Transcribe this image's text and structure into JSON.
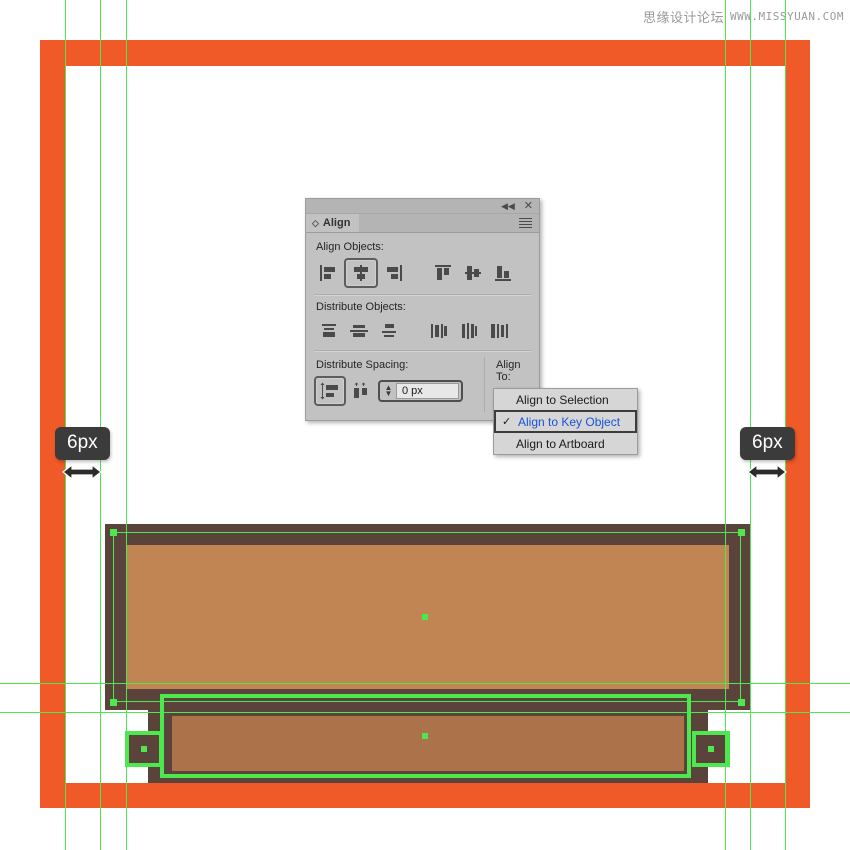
{
  "watermark": {
    "chinese": "思缘设计论坛",
    "url": "WWW.MISSYUAN.COM"
  },
  "panel": {
    "tab_label": "Align",
    "collapse_icon": "double-chevron-left-icon",
    "close_icon": "close-icon",
    "menu_icon": "hamburger-menu-icon",
    "sections": {
      "align_objects_label": "Align Objects:",
      "distribute_objects_label": "Distribute Objects:",
      "distribute_spacing_label": "Distribute Spacing:",
      "align_to_label": "Align To:"
    },
    "align_objects_buttons": [
      {
        "name": "horizontal-align-left",
        "selected": false
      },
      {
        "name": "horizontal-align-center",
        "selected": true
      },
      {
        "name": "horizontal-align-right",
        "selected": false
      },
      {
        "name": "vertical-align-top",
        "selected": false
      },
      {
        "name": "vertical-align-center",
        "selected": false
      },
      {
        "name": "vertical-align-bottom",
        "selected": false
      }
    ],
    "distribute_objects_buttons": [
      {
        "name": "vertical-distribute-top",
        "selected": false
      },
      {
        "name": "vertical-distribute-center",
        "selected": false
      },
      {
        "name": "vertical-distribute-bottom",
        "selected": false
      },
      {
        "name": "horizontal-distribute-left",
        "selected": false
      },
      {
        "name": "horizontal-distribute-center",
        "selected": false
      },
      {
        "name": "horizontal-distribute-right",
        "selected": false
      }
    ],
    "distribute_spacing_buttons": [
      {
        "name": "vertical-distribute-spacing",
        "selected": true
      },
      {
        "name": "horizontal-distribute-spacing",
        "selected": false
      }
    ],
    "spacing_value": "0 px",
    "spacing_placeholder": "0 px",
    "align_to_button_icon": "align-to-key-object-icon"
  },
  "dropdown": {
    "items": [
      {
        "label": "Align to Selection",
        "checked": false,
        "highlighted": false
      },
      {
        "label": "Align to Key Object",
        "checked": true,
        "highlighted": true
      },
      {
        "label": "Align to Artboard",
        "checked": false,
        "highlighted": false
      }
    ],
    "check_glyph": "✓"
  },
  "measurements": [
    {
      "name": "left-gap-measure",
      "value": "6px"
    },
    {
      "name": "right-gap-measure",
      "value": "6px"
    }
  ],
  "colors": {
    "orange_frame": "#F05A28",
    "brown_dark": "#59433A",
    "tan_fill": "#C08552",
    "tan_fill_lower": "#AC7249",
    "guide_green": "#4DE84D",
    "selection_green": "#4DE84D",
    "panel_gray": "#C2C2C2",
    "highlight_blue": "#1753D8",
    "tooltip_dark": "#3B3B3B"
  },
  "artboard": {
    "guides_vertical": [
      65,
      100,
      126,
      725,
      750,
      785
    ],
    "guides_horizontal": [
      683,
      712
    ]
  }
}
